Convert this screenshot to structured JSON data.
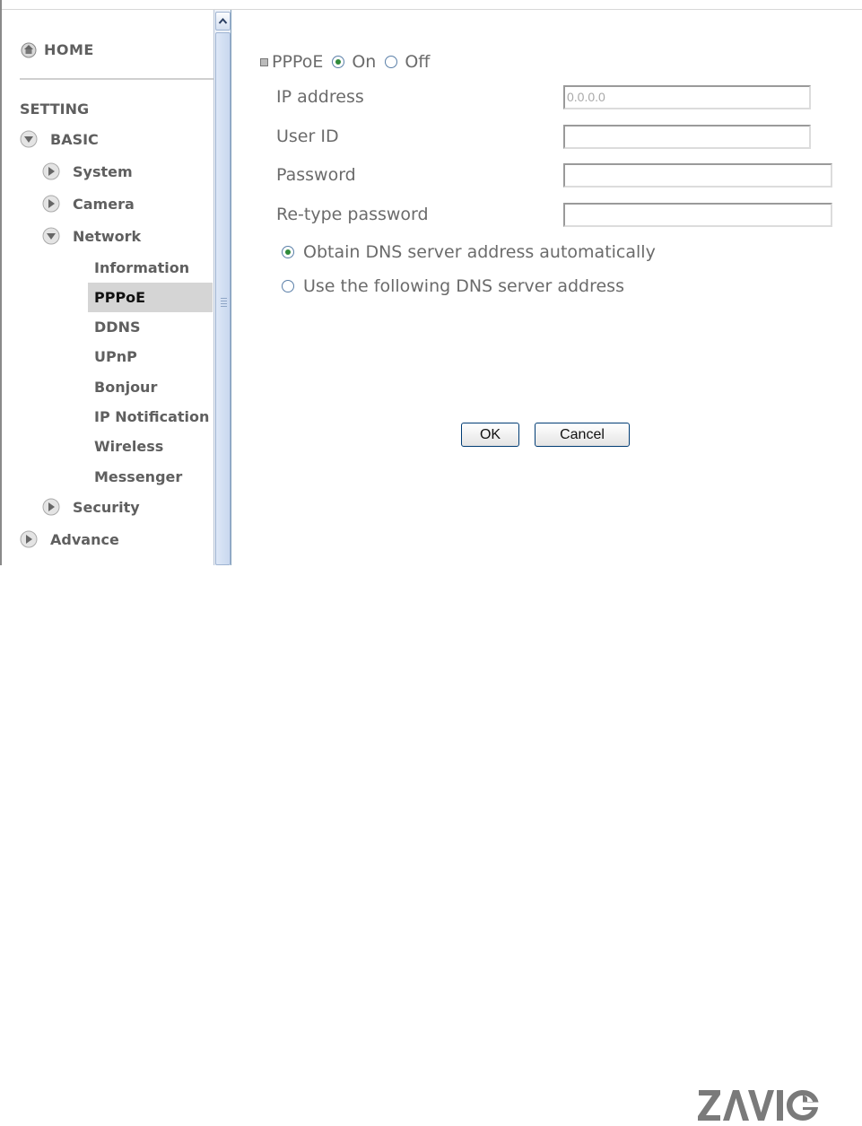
{
  "sidebar": {
    "home": "HOME",
    "setting": "SETTING",
    "basic": "BASIC",
    "system": "System",
    "camera": "Camera",
    "network": "Network",
    "network_items": [
      "Information",
      "PPPoE",
      "DDNS",
      "UPnP",
      "Bonjour",
      "IP Notification",
      "Wireless",
      "Messenger"
    ],
    "active_item": "PPPoE",
    "security": "Security",
    "advance": "Advance"
  },
  "pppoe": {
    "title": "PPPoE",
    "on_label": "On",
    "off_label": "Off",
    "selected": "On"
  },
  "form": {
    "ip_label": "IP address",
    "ip_value": "0.0.0.0",
    "user_label": "User ID",
    "user_value": "",
    "password_label": "Password",
    "password_value": "",
    "retype_label": "Re-type password",
    "retype_value": ""
  },
  "dns": {
    "auto_label": "Obtain DNS server address automatically",
    "manual_label": "Use the following DNS server address",
    "selected": "auto"
  },
  "buttons": {
    "ok": "OK",
    "cancel": "Cancel"
  },
  "brand": {
    "logo_text": "ZAVIO"
  },
  "colors": {
    "radio_dot": "#2f8a3a",
    "active_bg": "#d5d5d5",
    "button_border": "#003c74"
  }
}
